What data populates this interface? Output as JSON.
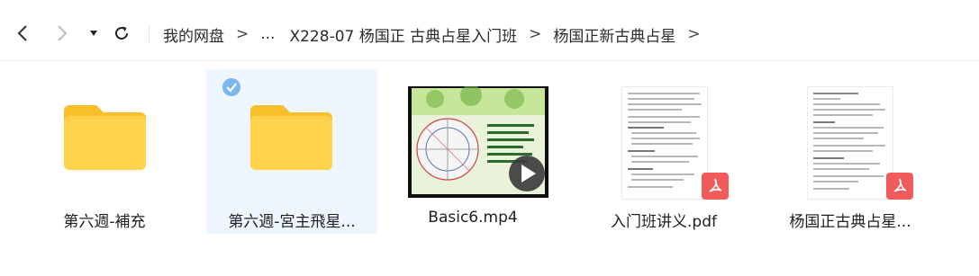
{
  "toolbar": {
    "back_icon": "chevron-left-icon",
    "forward_icon": "chevron-right-icon",
    "history_icon": "caret-down-icon",
    "refresh_icon": "refresh-icon"
  },
  "breadcrumb": {
    "items": [
      "我的网盘",
      "...",
      "X228-07 杨国正 古典占星入门班",
      "杨国正新古典占星"
    ],
    "separator": ">"
  },
  "files": [
    {
      "name": "第六週-補充",
      "type": "folder",
      "selected": false
    },
    {
      "name": "第六週-宮主飛星...",
      "type": "folder",
      "selected": true
    },
    {
      "name": "Basic6.mp4",
      "type": "video",
      "selected": false
    },
    {
      "name": "入门班讲义.pdf",
      "type": "pdf",
      "selected": false
    },
    {
      "name": "杨国正古典占星...",
      "type": "pdf",
      "selected": false
    }
  ],
  "colors": {
    "folder": "#ffd24d",
    "folder_tab": "#f9bf2a",
    "selection_bg": "#eef6ff",
    "check": "#79b6f2",
    "pdf_badge": "#f25b5b"
  }
}
